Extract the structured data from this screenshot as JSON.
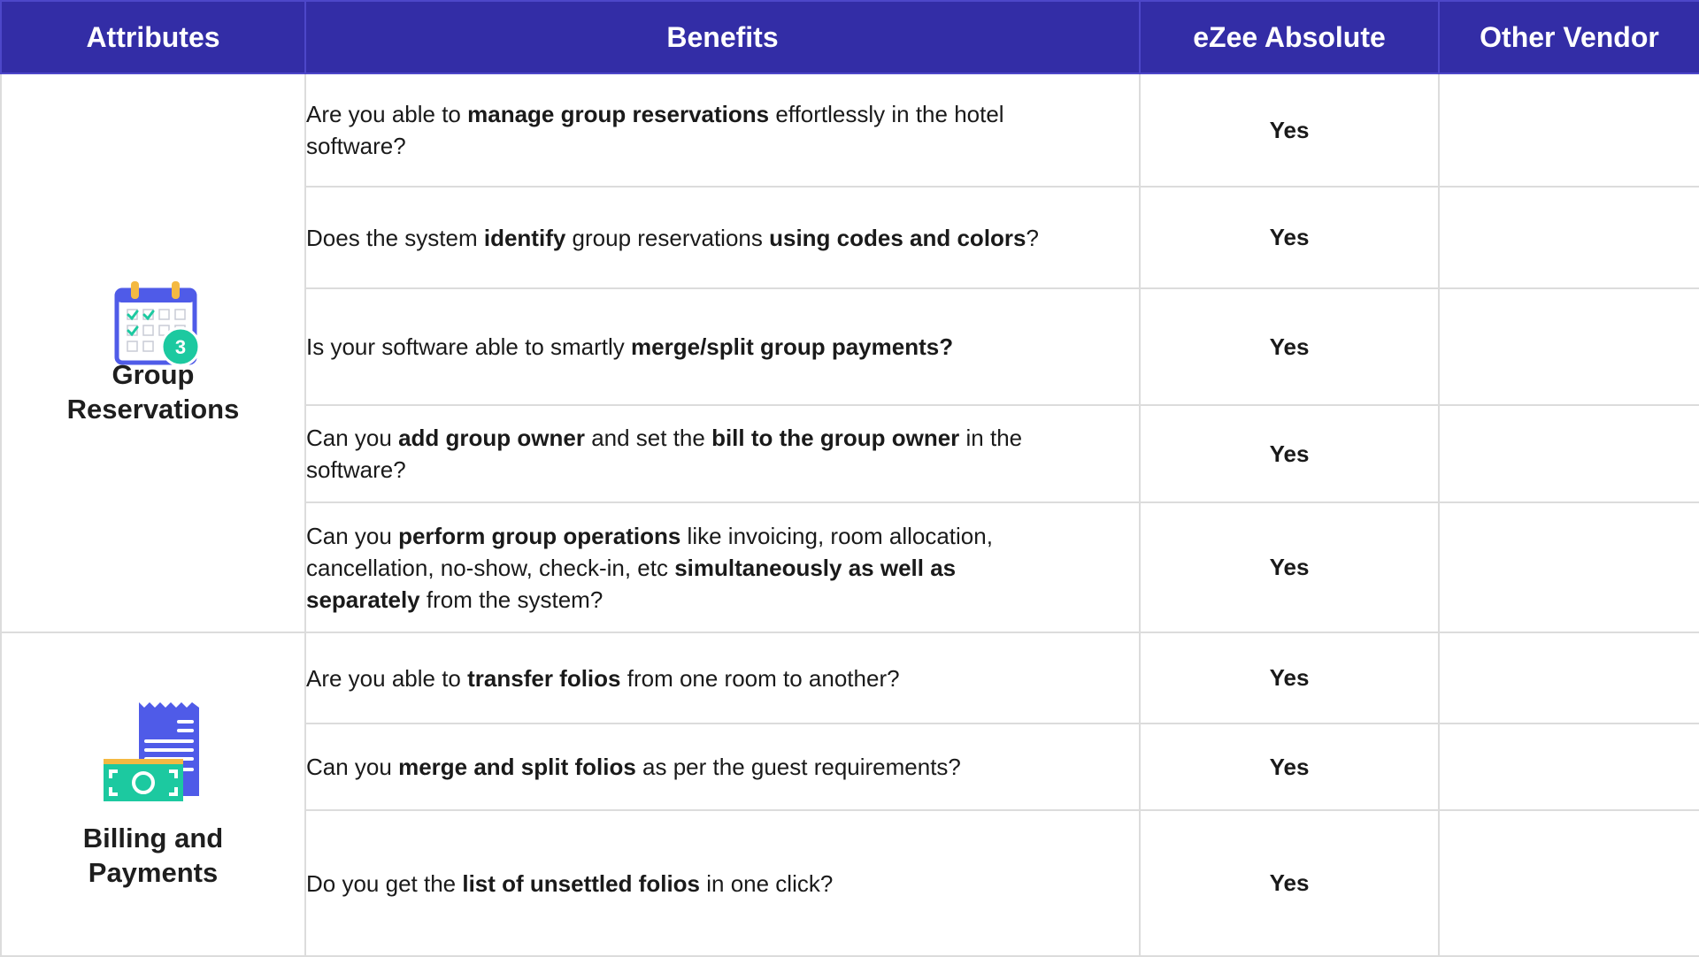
{
  "table": {
    "headers": [
      "Attributes",
      "Benefits",
      "eZee Absolute",
      "Other Vendor"
    ],
    "groups": [
      {
        "name": "Group Reservations",
        "name_lines": [
          "Group",
          "Reservations"
        ],
        "icon": "calendar-icon",
        "badge": "3",
        "rows": [
          {
            "segments": [
              {
                "t": "Are you able to ",
                "b": false
              },
              {
                "t": "manage group reservations",
                "b": true
              },
              {
                "t": " effortlessly in the hotel software?",
                "b": false
              }
            ],
            "ezee": "Yes",
            "other": ""
          },
          {
            "segments": [
              {
                "t": "Does the system ",
                "b": false
              },
              {
                "t": "identify",
                "b": true
              },
              {
                "t": " group reservations ",
                "b": false
              },
              {
                "t": "using codes and colors",
                "b": true
              },
              {
                "t": "?",
                "b": false
              }
            ],
            "ezee": "Yes",
            "other": ""
          },
          {
            "segments": [
              {
                "t": "Is your software able to smartly ",
                "b": false
              },
              {
                "t": "merge/split group payments?",
                "b": true
              }
            ],
            "ezee": "Yes",
            "other": ""
          },
          {
            "segments": [
              {
                "t": "Can you ",
                "b": false
              },
              {
                "t": "add group owner",
                "b": true
              },
              {
                "t": " and set the ",
                "b": false
              },
              {
                "t": "bill to the group owner",
                "b": true
              },
              {
                "t": " in the software?",
                "b": false
              }
            ],
            "ezee": "Yes",
            "other": ""
          },
          {
            "segments": [
              {
                "t": "Can you ",
                "b": false
              },
              {
                "t": "perform group operations",
                "b": true
              },
              {
                "t": " like invoicing, room allocation, cancellation, no-show, check-in, etc ",
                "b": false
              },
              {
                "t": "simultaneously as well as separately",
                "b": true
              },
              {
                "t": " from the system?",
                "b": false
              }
            ],
            "ezee": "Yes",
            "other": ""
          }
        ]
      },
      {
        "name": "Billing and Payments",
        "name_lines": [
          "Billing and",
          "Payments"
        ],
        "icon": "billing-receipt-icon",
        "rows": [
          {
            "segments": [
              {
                "t": "Are you able to ",
                "b": false
              },
              {
                "t": "transfer folios",
                "b": true
              },
              {
                "t": " from one room to another?",
                "b": false
              }
            ],
            "ezee": "Yes",
            "other": ""
          },
          {
            "segments": [
              {
                "t": "Can you ",
                "b": false
              },
              {
                "t": "merge and split folios",
                "b": true
              },
              {
                "t": " as per the guest requirements?",
                "b": false
              }
            ],
            "ezee": "Yes",
            "other": ""
          },
          {
            "segments": [
              {
                "t": "Do you get the ",
                "b": false
              },
              {
                "t": "list of unsettled folios",
                "b": true
              },
              {
                "t": " in one click?",
                "b": false
              }
            ],
            "ezee": "Yes",
            "other": ""
          }
        ]
      }
    ]
  },
  "colors": {
    "header_bg": "#332da6",
    "header_text": "#ffffff",
    "grid": "#dcdcdc",
    "icon_blue": "#4f5be8",
    "icon_green": "#1cc9a0"
  }
}
